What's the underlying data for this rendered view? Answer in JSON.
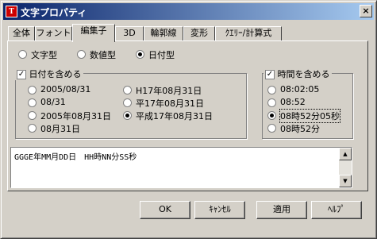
{
  "window": {
    "title": "文字プロパティ",
    "icon_letter": "T",
    "close_glyph": "×"
  },
  "tabs": [
    {
      "label": "全体",
      "active": false
    },
    {
      "label": "フォント",
      "active": false
    },
    {
      "label": "編集子",
      "active": true
    },
    {
      "label": "3D",
      "active": false
    },
    {
      "label": "輪郭線",
      "active": false
    },
    {
      "label": "変形",
      "active": false
    },
    {
      "label": "ｸｴﾘｰ/計算式",
      "active": false
    }
  ],
  "type_options": [
    {
      "label": "文字型",
      "selected": false
    },
    {
      "label": "数値型",
      "selected": false
    },
    {
      "label": "日付型",
      "selected": true
    }
  ],
  "date_group": {
    "label": "日付を含める",
    "checked": true,
    "check_glyph": "✓",
    "left_options": [
      {
        "label": "2005/08/31",
        "selected": false
      },
      {
        "label": "08/31",
        "selected": false
      },
      {
        "label": "2005年08月31日",
        "selected": false
      },
      {
        "label": "08月31日",
        "selected": false
      }
    ],
    "right_options": [
      {
        "label": "H17年08月31日",
        "selected": false
      },
      {
        "label": "平17年08月31日",
        "selected": false
      },
      {
        "label": "平成17年08月31日",
        "selected": true
      }
    ]
  },
  "time_group": {
    "label": "時間を含める",
    "checked": true,
    "check_glyph": "✓",
    "options": [
      {
        "label": "08:02:05",
        "selected": false
      },
      {
        "label": "08:52",
        "selected": false
      },
      {
        "label": "08時52分05秒",
        "selected": true
      },
      {
        "label": "08時52分",
        "selected": false
      }
    ]
  },
  "format_text": "GGGE年MM月DD日　HH時NN分SS秒",
  "scroll": {
    "up_glyph": "▲",
    "down_glyph": "▼"
  },
  "buttons": {
    "ok": "OK",
    "cancel": "ｷｬﾝｾﾙ",
    "apply": "適用",
    "help": "ﾍﾙﾌﾟ"
  }
}
